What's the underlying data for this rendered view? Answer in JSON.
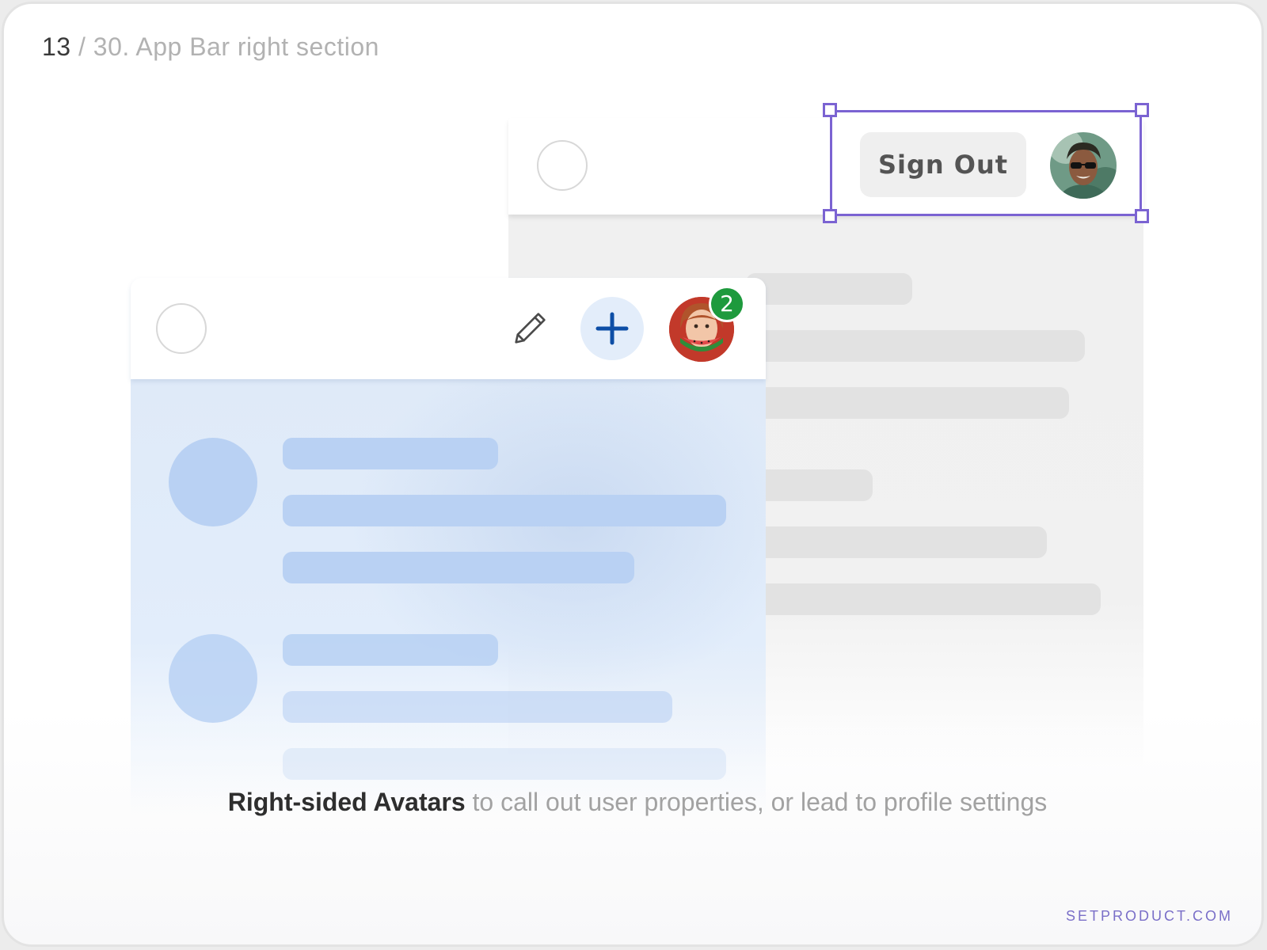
{
  "header": {
    "slide_number": "13",
    "separator": "/",
    "slide_title": "30. App Bar right section"
  },
  "back_app_bar": {
    "nav_icon": "circle-placeholder-icon",
    "sign_out_label": "Sign Out",
    "avatar_icon": "user-avatar-photo"
  },
  "front_app_bar": {
    "nav_icon": "circle-placeholder-icon",
    "edit_icon": "pencil-icon",
    "add_icon": "plus-icon",
    "avatar_icon": "user-avatar-photo",
    "notification_count": "2"
  },
  "caption": {
    "bold": "Right-sided Avatars",
    "rest": " to call out user properties, or lead to profile settings"
  },
  "footer": {
    "link": "SETPRODUCT.COM"
  },
  "colors": {
    "selection": "#7b63d2",
    "accent_blue": "#0d4ea6",
    "badge_green": "#1e9a3d",
    "placeholder_blue": "#b9d1f3",
    "placeholder_gray": "#e2e2e2"
  }
}
